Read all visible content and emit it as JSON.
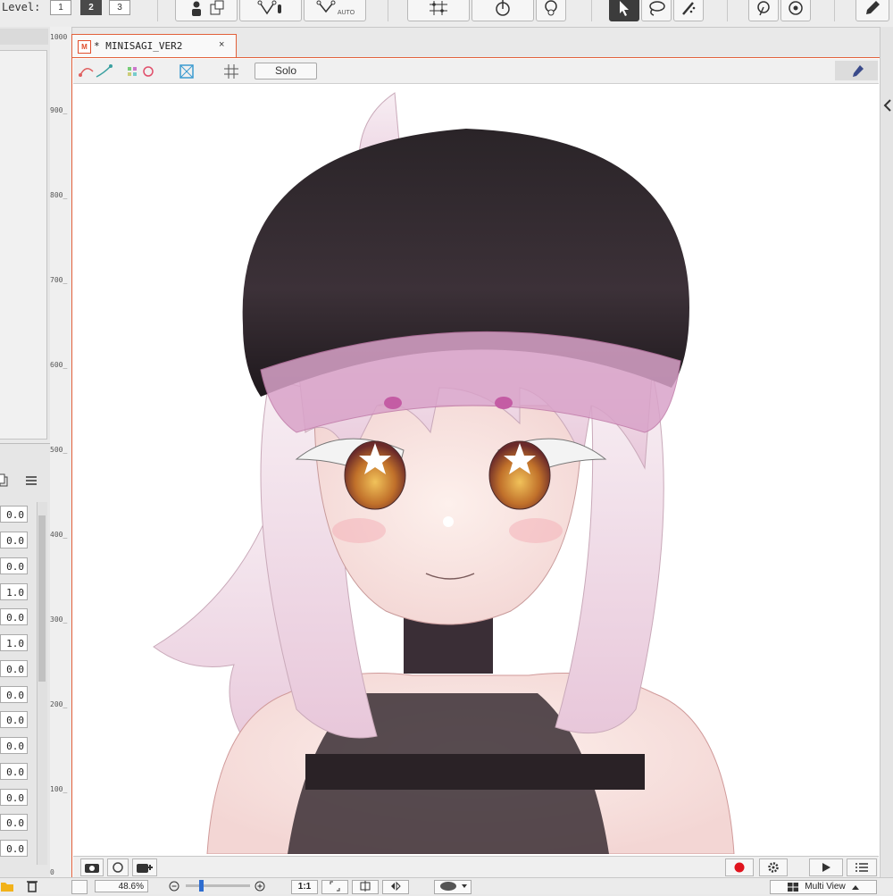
{
  "toolbar": {
    "level_label": "Level:",
    "levels": [
      "1",
      "2",
      "3"
    ],
    "auto_label": "AUTO"
  },
  "document": {
    "tab_title": "* MINISAGI_VER2",
    "close_glyph": "×"
  },
  "view_toolbar": {
    "solo_label": "Solo"
  },
  "ruler": {
    "ticks": [
      "1000",
      "900_",
      "800_",
      "700_",
      "600_",
      "500_",
      "400_",
      "300_",
      "200_",
      "100_",
      "0"
    ]
  },
  "parameters": {
    "values": [
      "0.0",
      "0.0",
      "0.0",
      "1.0",
      "0.0",
      "1.0",
      "0.0",
      "0.0",
      "0.0",
      "0.0",
      "0.0",
      "0.0",
      "0.0",
      "0.0"
    ]
  },
  "bottom_bar": {
    "zoom_value": "48.6",
    "zoom_unit": "%",
    "ratio_label": "1:1",
    "multi_view_label": "Multi View"
  },
  "colors": {
    "accent_orange": "#e2603a",
    "record_red": "#e0141e",
    "hat_black": "#2a2428",
    "hair_pink": "#f1dde8"
  },
  "icons": [
    "person-icon",
    "deformer-icon",
    "auto-deformer-icon",
    "mesh-icon",
    "glue-icon",
    "brush-icon",
    "arrow-select-icon",
    "lasso-icon",
    "pin-icon"
  ]
}
